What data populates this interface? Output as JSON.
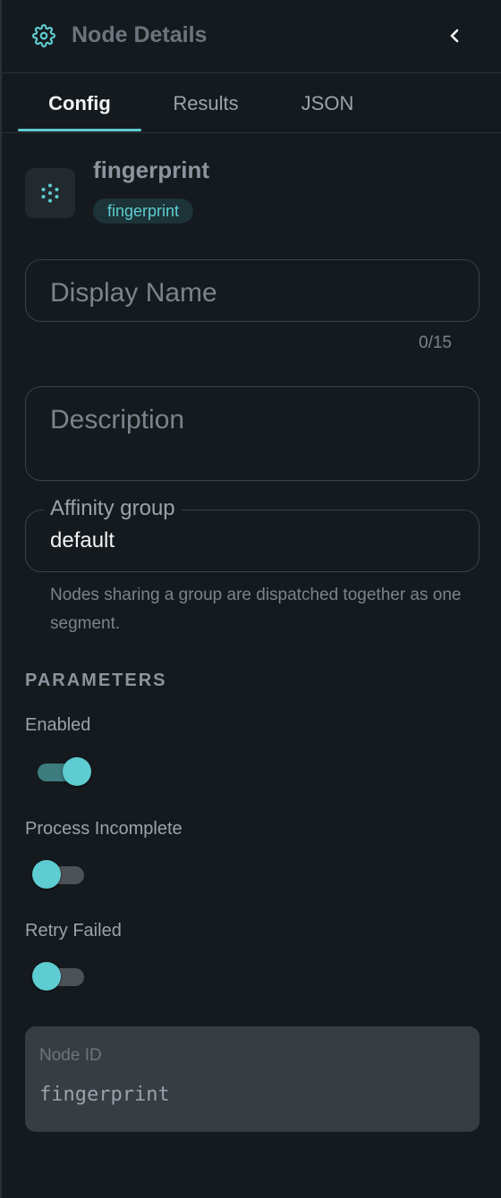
{
  "header": {
    "title": "Node Details",
    "icon": "gear-icon",
    "back_icon": "chevron-left-icon"
  },
  "tabs": [
    {
      "label": "Config",
      "active": true
    },
    {
      "label": "Results",
      "active": false
    },
    {
      "label": "JSON",
      "active": false
    }
  ],
  "node": {
    "name": "fingerprint",
    "type_badge": "fingerprint",
    "icon": "fingerprint-dots-icon"
  },
  "form": {
    "display_name": {
      "placeholder": "Display Name",
      "value": "",
      "counter": "0/15"
    },
    "description": {
      "placeholder": "Description",
      "value": ""
    },
    "affinity_group": {
      "label": "Affinity group",
      "value": "default",
      "helper": "Nodes sharing a group are dispatched together as one segment."
    }
  },
  "parameters": {
    "heading": "PARAMETERS",
    "items": [
      {
        "label": "Enabled",
        "on": true
      },
      {
        "label": "Process Incomplete",
        "on": false
      },
      {
        "label": "Retry Failed",
        "on": false
      }
    ]
  },
  "node_id": {
    "label": "Node ID",
    "value": "fingerprint"
  },
  "colors": {
    "accent": "#5ecdd1",
    "background": "#151a1e",
    "id_box": "#363d43"
  }
}
